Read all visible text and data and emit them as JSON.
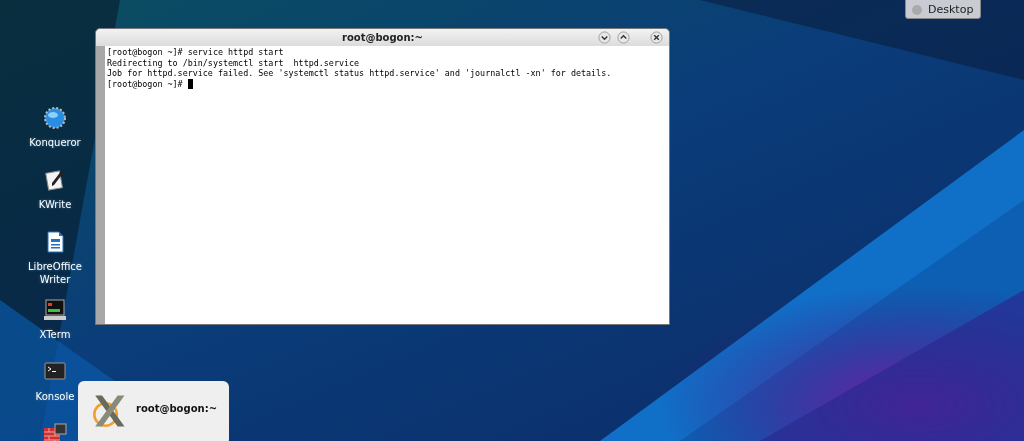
{
  "desktop_button": {
    "label": "Desktop"
  },
  "desktop_icons": [
    {
      "label": "Konqueror",
      "kind": "globe"
    },
    {
      "label": "KWrite",
      "kind": "pen"
    },
    {
      "label": "LibreOffice Writer",
      "kind": "document"
    },
    {
      "label": "XTerm",
      "kind": "xterm"
    },
    {
      "label": "Konsole",
      "kind": "console"
    },
    {
      "kind": "firewall"
    }
  ],
  "terminal": {
    "title": "root@bogon:~",
    "lines": [
      "[root@bogon ~]# service httpd start",
      "Redirecting to /bin/systemctl start  httpd.service",
      "Job for httpd.service failed. See 'systemctl status httpd.service' and 'journalctl -xn' for details.",
      "[root@bogon ~]# "
    ]
  },
  "window_switcher": {
    "title": "root@bogon:~"
  }
}
